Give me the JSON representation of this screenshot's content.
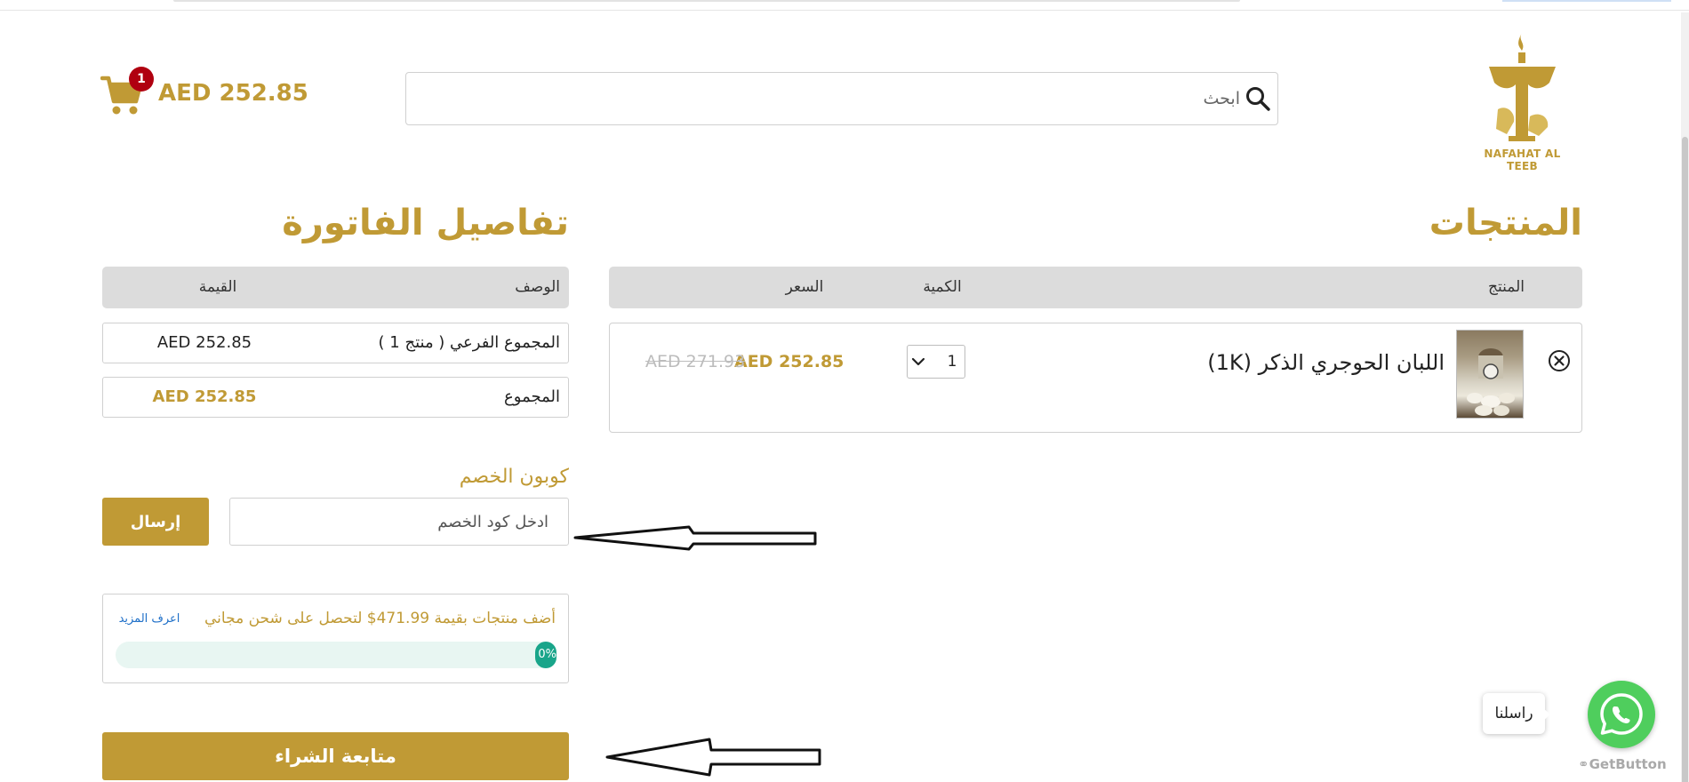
{
  "header": {
    "logo_text": "NAFAHAT AL TEEB",
    "search_placeholder": "ابحث",
    "cart_count": "1",
    "cart_total": "AED 252.85"
  },
  "products": {
    "title": "المنتجات",
    "columns": {
      "product": "المنتج",
      "quantity": "الكمية",
      "price": "السعر"
    },
    "items": [
      {
        "name": "اللبان الحوجري الذكر (1K)",
        "quantity": "1",
        "price": "AED 252.85",
        "old_price": "AED 271.93"
      }
    ]
  },
  "invoice": {
    "title": "تفاصيل الفاتورة",
    "columns": {
      "description": "الوصف",
      "value": "القيمة"
    },
    "rows": [
      {
        "label": "المجموع الفرعي ( منتج 1 )",
        "value": "AED 252.85"
      },
      {
        "label": "المجموع",
        "value": "AED 252.85"
      }
    ]
  },
  "coupon": {
    "title": "كوبون الخصم",
    "placeholder": "ادخل كود الخصم",
    "submit_label": "إرسال"
  },
  "shipping": {
    "message": "أضف منتجات بقيمة 471.99$ لتحصل على شحن مجاني",
    "learn_more": "اعرف المزيد",
    "progress_percent": 0,
    "progress_label": "0%"
  },
  "checkout": {
    "label": "متابعة الشراء"
  },
  "whatsapp": {
    "tooltip": "راسلنا",
    "brand": "GetButton"
  },
  "colors": {
    "gold": "#c09a35",
    "badge_red": "#b00010",
    "progress_green": "#19a58a",
    "whatsapp_green": "#4fce5d",
    "link_blue": "#1e6fc8"
  }
}
